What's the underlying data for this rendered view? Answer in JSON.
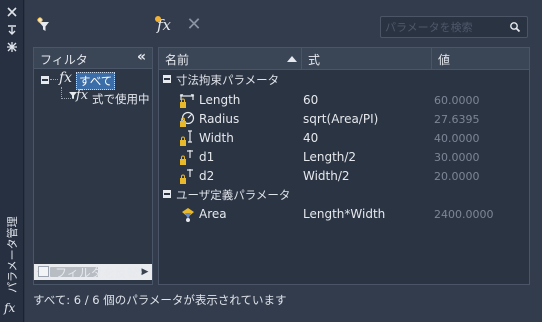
{
  "side_strip": {
    "title": "パラメータ管理",
    "icons": [
      "close-icon",
      "auto-hide-icon",
      "properties-icon"
    ],
    "fx_label": "fx"
  },
  "toolbar": {
    "fx_label": "fx",
    "delete_label": "✕",
    "search_placeholder": "パラメータを検索"
  },
  "filter": {
    "header": "フィルタ",
    "collapse_label": "«",
    "tree": [
      {
        "label": "すべて",
        "selected": true
      },
      {
        "label": "式で使用中",
        "selected": false
      }
    ],
    "invert_label": "フィルタを反転",
    "invert_checked": false,
    "invert_collapse": "«"
  },
  "grid": {
    "columns": {
      "name": "名前",
      "expression": "式",
      "value": "値"
    },
    "groups": [
      {
        "label": "寸法拘束パラメータ",
        "rows": [
          {
            "name": "Length",
            "expression": "60",
            "value": "60.0000",
            "icon": "linear-dim-lock-icon"
          },
          {
            "name": "Radius",
            "expression": "sqrt(Area/PI)",
            "value": "27.6395",
            "icon": "radius-dim-lock-icon"
          },
          {
            "name": "Width",
            "expression": "40",
            "value": "40.0000",
            "icon": "vertical-dim-lock-icon"
          },
          {
            "name": "d1",
            "expression": "Length/2",
            "value": "30.0000",
            "icon": "linear-dim-lock-icon"
          },
          {
            "name": "d2",
            "expression": "Width/2",
            "value": "20.0000",
            "icon": "linear-dim-lock-icon"
          }
        ]
      },
      {
        "label": "ユーザ定義パラメータ",
        "rows": [
          {
            "name": "Area",
            "expression": "Length*Width",
            "value": "2400.0000",
            "icon": "user-param-icon"
          }
        ]
      }
    ]
  },
  "status": "すべて: 6 / 6 個のパラメータが表示されています",
  "colors": {
    "background": "#323c4c",
    "selection": "#3b6ea8",
    "lock": "#e8b92a",
    "muted_value": "#7d8696"
  }
}
